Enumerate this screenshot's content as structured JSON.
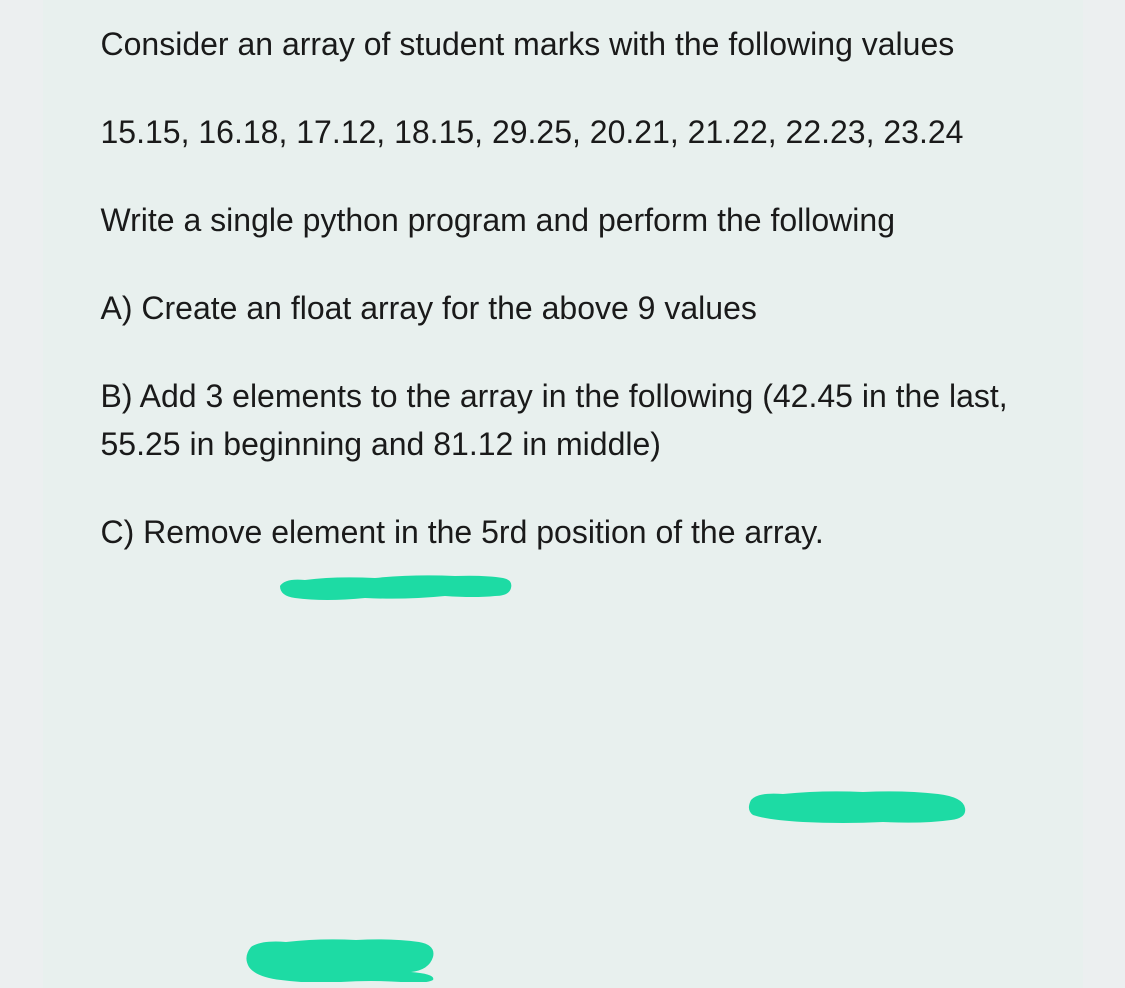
{
  "paragraphs": {
    "intro": "Consider an array of student marks with the following values",
    "values": "15.15, 16.18, 17.12, 18.15, 29.25, 20.21, 21.22, 22.23, 23.24",
    "instruction": "Write a single python program and perform the following",
    "taskA": "A) Create an float array for the above 9 values",
    "taskB": "B) Add 3 elements to the array in the following (42.45 in the last, 55.25 in beginning and 81.12 in middle)",
    "taskC": "C) Remove element in the 5rd position of the array."
  },
  "highlight_color": "#1ddba4"
}
